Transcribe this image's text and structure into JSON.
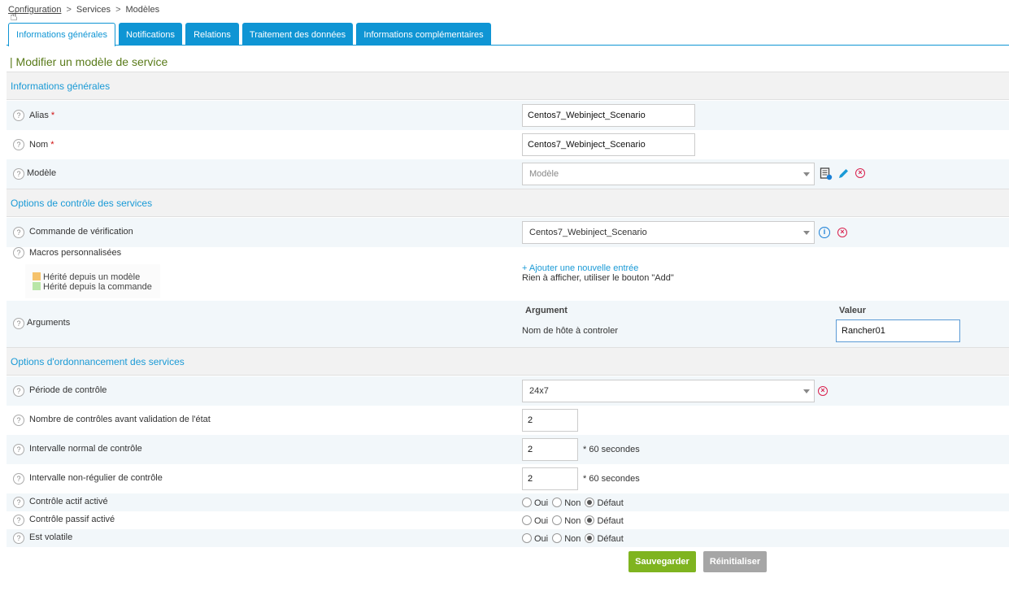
{
  "breadcrumb": {
    "items": [
      "Configuration",
      "Services",
      "Modèles"
    ],
    "separator": ">"
  },
  "tabs": [
    {
      "label": "Informations générales",
      "active": true
    },
    {
      "label": "Notifications"
    },
    {
      "label": "Relations"
    },
    {
      "label": "Traitement des données"
    },
    {
      "label": "Informations complémentaires"
    }
  ],
  "page_title": "| Modifier un modèle de service",
  "sections": {
    "general": "Informations générales",
    "control": "Options de contrôle des services",
    "scheduling": "Options d'ordonnancement des services"
  },
  "fields": {
    "alias": {
      "label": "Alias",
      "required": "*",
      "value": "Centos7_Webinject_Scenario"
    },
    "nom": {
      "label": "Nom",
      "required": "*",
      "value": "Centos7_Webinject_Scenario"
    },
    "modele": {
      "label": "Modèle",
      "placeholder": "Modèle"
    },
    "commande": {
      "label": "Commande de vérification",
      "value": "Centos7_Webinject_Scenario"
    },
    "macros": {
      "label": "Macros personnalisées",
      "legend_template": "Hérité depuis un modèle",
      "legend_command": "Hérité depuis la commande",
      "add_link": "+ Ajouter une nouvelle entrée",
      "empty_text": "Rien à afficher, utiliser le bouton \"Add\""
    },
    "arguments": {
      "label": "Arguments",
      "col_argument": "Argument",
      "col_valeur": "Valeur",
      "arg_name": "Nom de hôte à controler",
      "arg_value": "Rancher01"
    },
    "periode": {
      "label": "Période de contrôle",
      "value": "24x7"
    },
    "nb_controles": {
      "label": "Nombre de contrôles avant validation de l'état",
      "value": "2"
    },
    "intervalle_normal": {
      "label": "Intervalle normal de contrôle",
      "value": "2",
      "suffix": "* 60 secondes"
    },
    "intervalle_non_regulier": {
      "label": "Intervalle non-régulier de contrôle",
      "value": "2",
      "suffix": "* 60 secondes"
    },
    "controle_actif": {
      "label": "Contrôle actif activé"
    },
    "controle_passif": {
      "label": "Contrôle passif activé"
    },
    "volatile": {
      "label": "Est volatile"
    }
  },
  "radio_labels": {
    "oui": "Oui",
    "non": "Non",
    "defaut": "Défaut"
  },
  "help_glyph": "?",
  "buttons": {
    "save": "Sauvegarder",
    "reset": "Réinitialiser"
  },
  "colors": {
    "accent": "#0f95d4",
    "section_text": "#1a9ad6",
    "title": "#5a7b1a",
    "save": "#7fb420",
    "reset": "#a6a6a6",
    "legend_template": "#f5c26b",
    "legend_command": "#b9e6a8",
    "delete": "#d9214e"
  }
}
